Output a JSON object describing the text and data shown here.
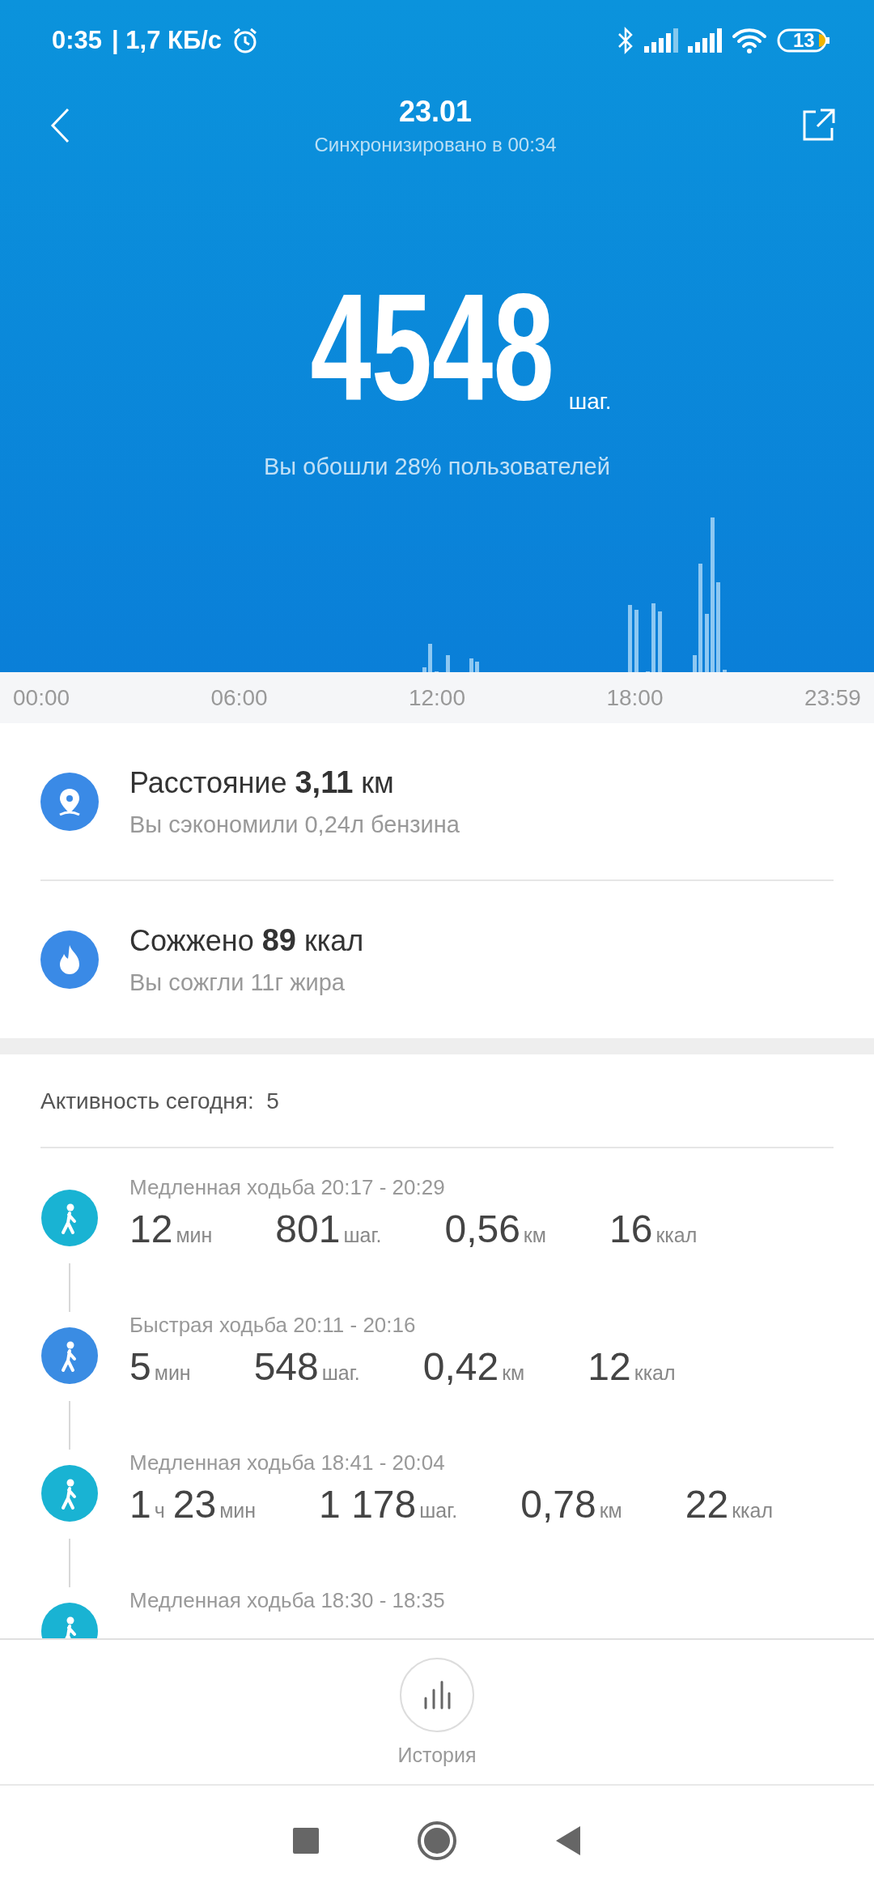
{
  "status_bar": {
    "time": "0:35",
    "speed": "| 1,7 КБ/с",
    "battery": "13"
  },
  "header": {
    "title": "23.01",
    "subtitle": "Синхронизировано в 00:34"
  },
  "steps": {
    "value": "4548",
    "unit": "шаг.",
    "note": "Вы обошли 28% пользователей"
  },
  "time_axis": [
    "00:00",
    "06:00",
    "12:00",
    "18:00",
    "23:59"
  ],
  "metrics": [
    {
      "kind": "distance",
      "label": "Расстояние",
      "value": "3,11",
      "unit": "км",
      "note": "Вы сэкономили 0,24л бензина"
    },
    {
      "kind": "calories",
      "label": "Сожжено",
      "value": "89",
      "unit": "ккал",
      "note": "Вы сожгли 11г жира"
    }
  ],
  "activity": {
    "label": "Активность сегодня:",
    "count": "5",
    "items": [
      {
        "title": "Медленная ходьба 20:17 - 20:29",
        "color": "#19b3d3",
        "stats": [
          [
            {
              "value": "12",
              "unit": "мин"
            }
          ],
          [
            {
              "value": "801",
              "unit": "шаг."
            }
          ],
          [
            {
              "value": "0,56",
              "unit": "км"
            }
          ],
          [
            {
              "value": "16",
              "unit": "ккал"
            }
          ]
        ]
      },
      {
        "title": "Быстрая ходьба 20:11 - 20:16",
        "color": "#3a8ce3",
        "stats": [
          [
            {
              "value": "5",
              "unit": "мин"
            }
          ],
          [
            {
              "value": "548",
              "unit": "шаг."
            }
          ],
          [
            {
              "value": "0,42",
              "unit": "км"
            }
          ],
          [
            {
              "value": "12",
              "unit": "ккал"
            }
          ]
        ]
      },
      {
        "title": "Медленная ходьба 18:41 - 20:04",
        "color": "#19b3d3",
        "stats": [
          [
            {
              "value": "1",
              "unit": "ч"
            },
            {
              "value": "23",
              "unit": "мин"
            }
          ],
          [
            {
              "value": "1 178",
              "unit": "шаг."
            }
          ],
          [
            {
              "value": "0,78",
              "unit": "км"
            }
          ],
          [
            {
              "value": "22",
              "unit": "ккал"
            }
          ]
        ]
      },
      {
        "title": "Медленная ходьба 18:30 - 18:35",
        "color": "#19b3d3"
      }
    ]
  },
  "history_button": {
    "label": "История"
  }
}
